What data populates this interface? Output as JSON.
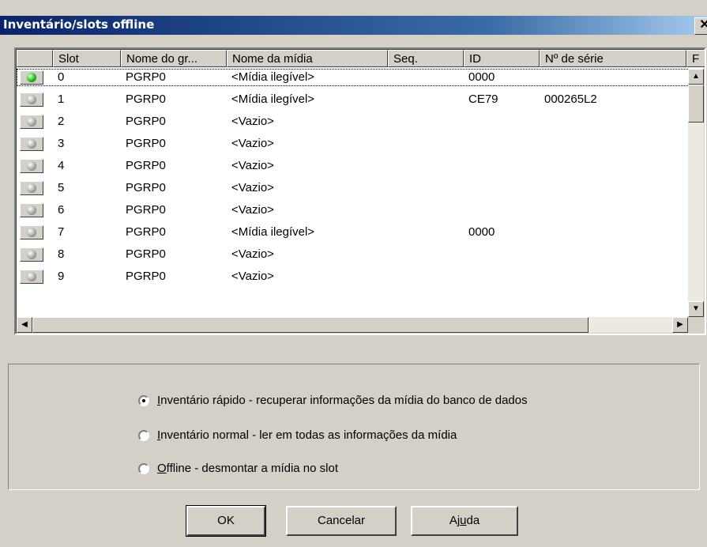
{
  "window": {
    "title": "Inventário/slots offline",
    "close_glyph": "✕"
  },
  "list": {
    "columns": [
      "Slot",
      "Nome do gr...",
      "Nome da mídia",
      "Seq.",
      "ID",
      "Nº de série",
      "F"
    ],
    "rows": [
      {
        "status": "online",
        "slot": "0",
        "group": "PGRP0",
        "media": "<Mídia ilegível>",
        "seq": "",
        "id": "0000",
        "serial": "",
        "f": ""
      },
      {
        "status": "offline",
        "slot": "1",
        "group": "PGRP0",
        "media": "<Mídia ilegível>",
        "seq": "",
        "id": "CE79",
        "serial": "000265L2",
        "f": ""
      },
      {
        "status": "offline",
        "slot": "2",
        "group": "PGRP0",
        "media": "<Vazio>",
        "seq": "",
        "id": "",
        "serial": "",
        "f": ""
      },
      {
        "status": "offline",
        "slot": "3",
        "group": "PGRP0",
        "media": "<Vazio>",
        "seq": "",
        "id": "",
        "serial": "",
        "f": ""
      },
      {
        "status": "offline",
        "slot": "4",
        "group": "PGRP0",
        "media": "<Vazio>",
        "seq": "",
        "id": "",
        "serial": "",
        "f": ""
      },
      {
        "status": "offline",
        "slot": "5",
        "group": "PGRP0",
        "media": "<Vazio>",
        "seq": "",
        "id": "",
        "serial": "",
        "f": ""
      },
      {
        "status": "offline",
        "slot": "6",
        "group": "PGRP0",
        "media": "<Vazio>",
        "seq": "",
        "id": "",
        "serial": "",
        "f": ""
      },
      {
        "status": "offline",
        "slot": "7",
        "group": "PGRP0",
        "media": "<Mídia ilegível>",
        "seq": "",
        "id": "0000",
        "serial": "",
        "f": ""
      },
      {
        "status": "offline",
        "slot": "8",
        "group": "PGRP0",
        "media": "<Vazio>",
        "seq": "",
        "id": "",
        "serial": "",
        "f": ""
      },
      {
        "status": "offline",
        "slot": "9",
        "group": "PGRP0",
        "media": "<Vazio>",
        "seq": "",
        "id": "",
        "serial": "",
        "f": ""
      }
    ]
  },
  "options": {
    "selected": 0,
    "items": [
      {
        "mnemonic": "I",
        "rest": "nventário rápido - recuperar informações da mídia do banco de dados"
      },
      {
        "mnemonic": "I",
        "rest": "nventário normal - ler em todas as informações da mídia"
      },
      {
        "mnemonic": "O",
        "rest": "ffline - desmontar a mídia no slot"
      }
    ]
  },
  "buttons": {
    "ok": "OK",
    "cancel": "Cancelar",
    "help_pre": "Aj",
    "help_mnemonic": "u",
    "help_post": "da"
  },
  "colors": {
    "face": "#d4d0c8",
    "title_start": "#0a246a",
    "title_end": "#a6caf0",
    "led_on": "#18c018"
  },
  "icons": {
    "status_online": "green-led-icon",
    "status_offline": "gray-led-icon",
    "scroll_up": "▲",
    "scroll_down": "▼",
    "scroll_left": "◀",
    "scroll_right": "▶"
  }
}
